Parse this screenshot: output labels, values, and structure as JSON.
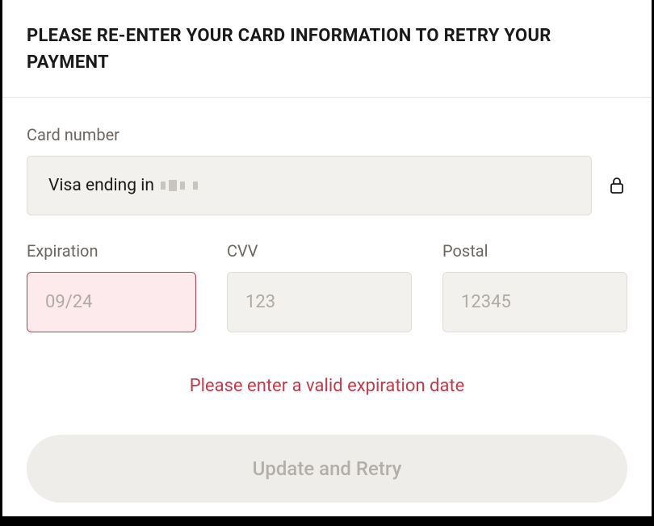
{
  "header": {
    "title": "PLEASE RE-ENTER YOUR CARD INFORMATION TO RETRY YOUR PAYMENT"
  },
  "card_number": {
    "label": "Card number",
    "display_prefix": "Visa ending in"
  },
  "expiration": {
    "label": "Expiration",
    "placeholder": "09/24",
    "value": ""
  },
  "cvv": {
    "label": "CVV",
    "placeholder": "123",
    "value": ""
  },
  "postal": {
    "label": "Postal",
    "placeholder": "12345",
    "value": ""
  },
  "error_message": "Please enter a valid expiration date",
  "submit_label": "Update and Retry",
  "icons": {
    "lock": "lock-icon"
  }
}
